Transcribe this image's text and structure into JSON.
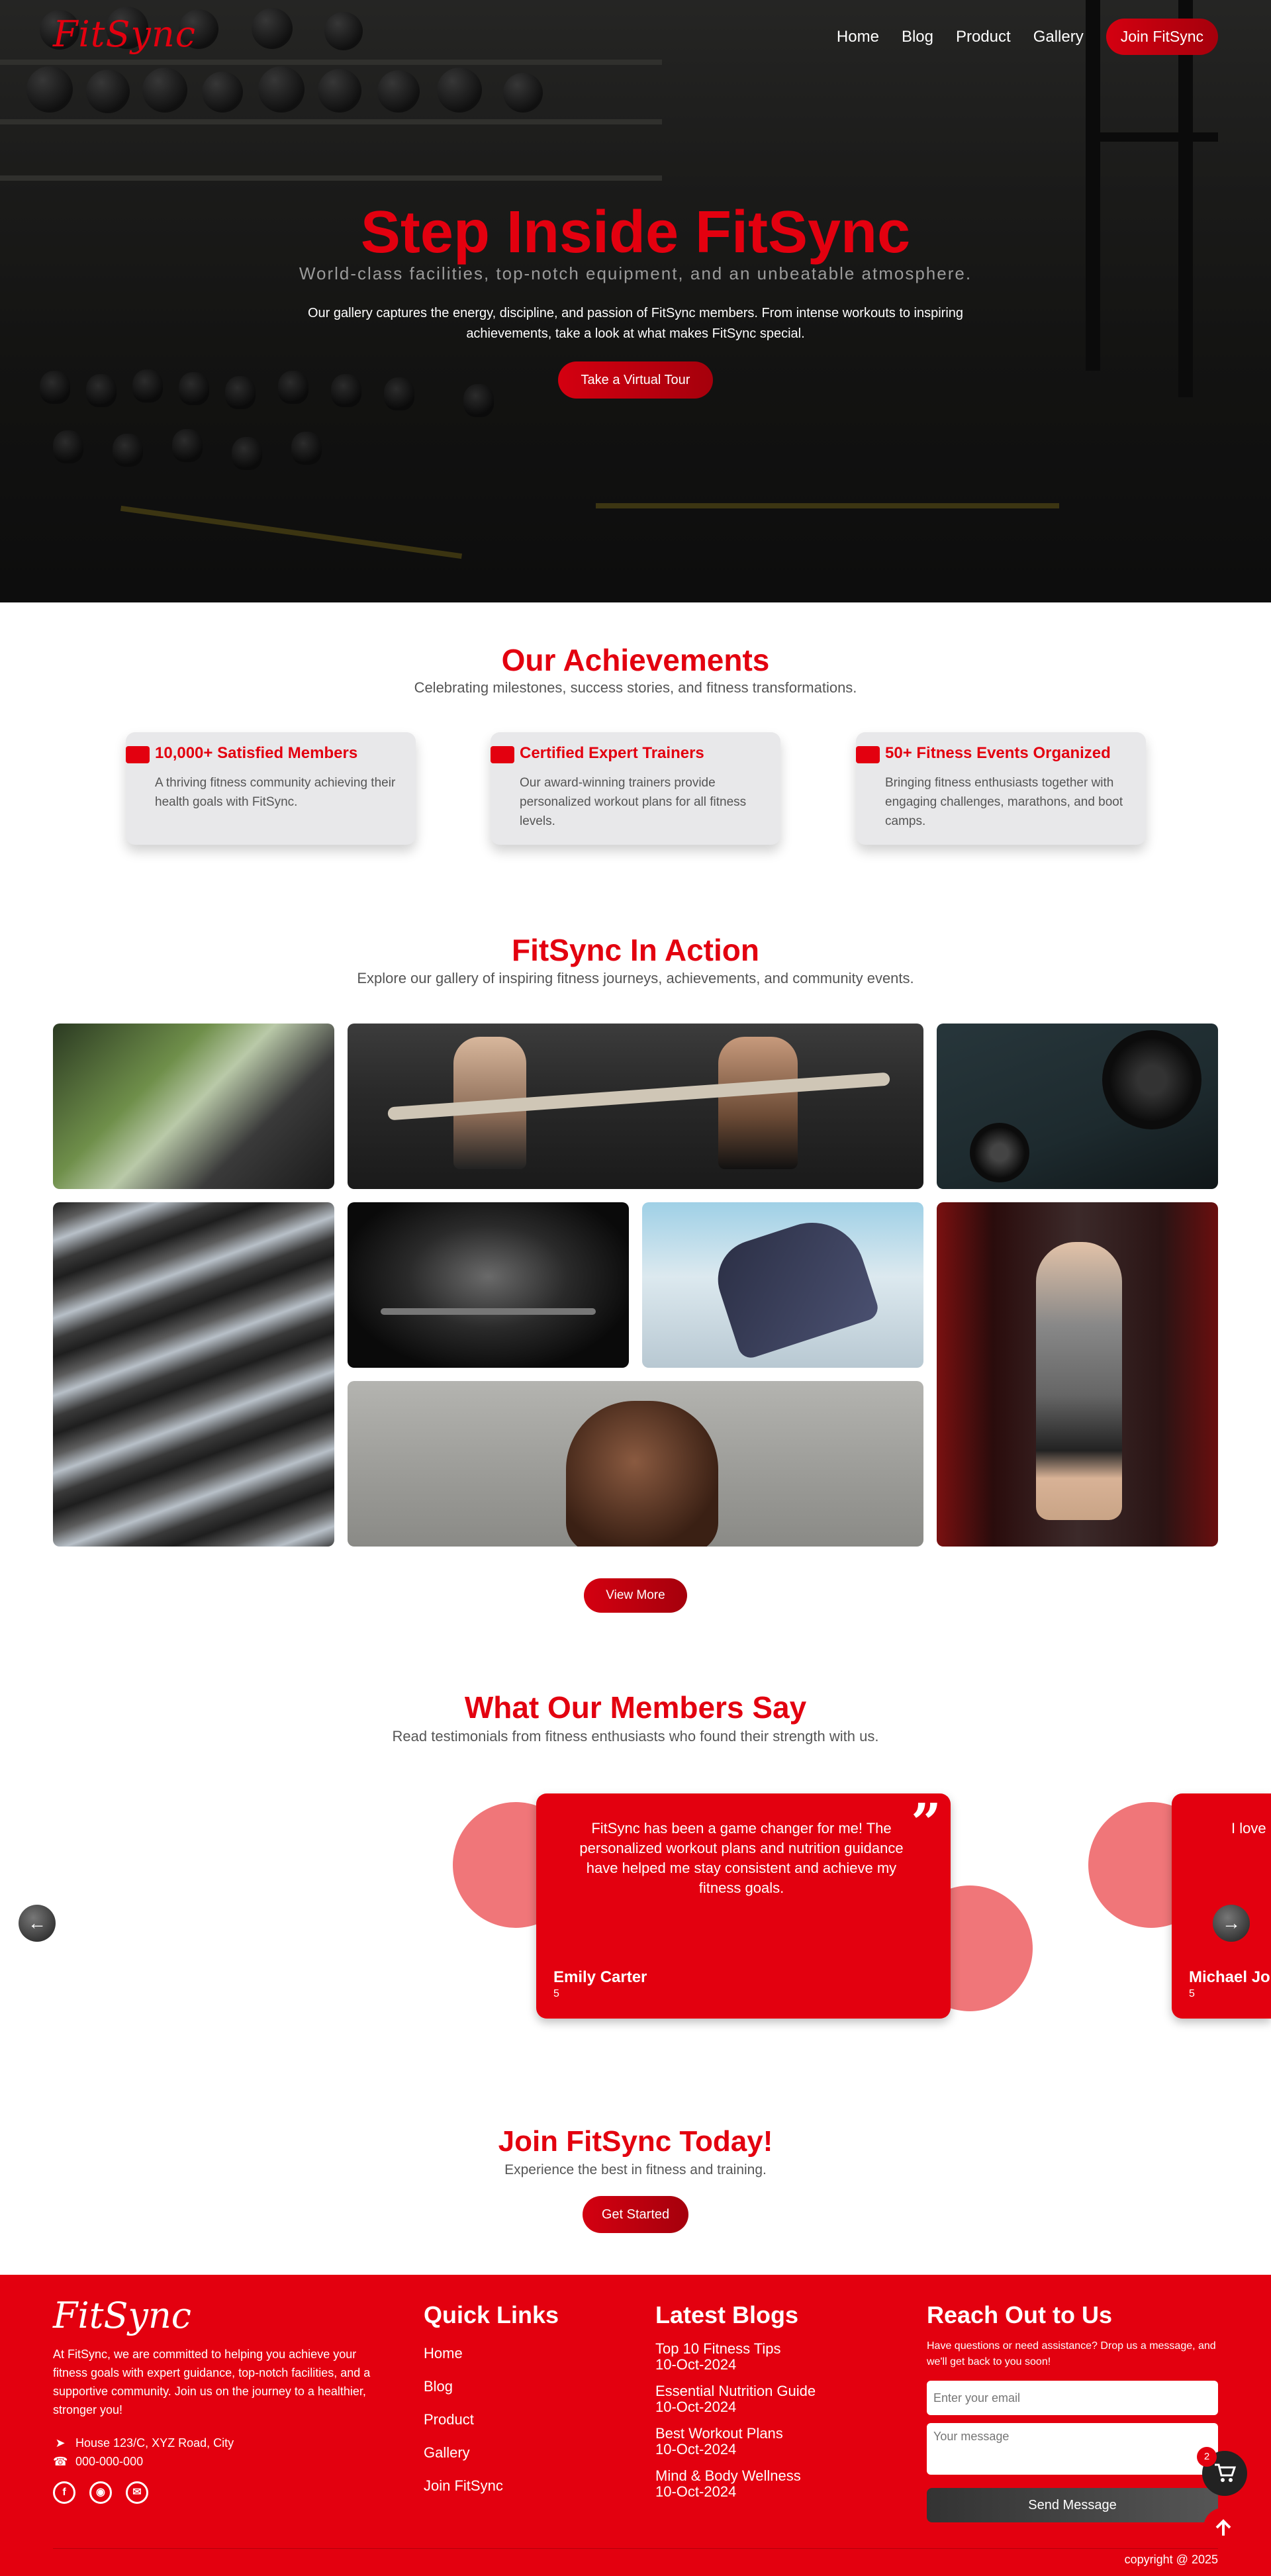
{
  "brand": {
    "logo_text": "FitSync",
    "accent": "#e3000f"
  },
  "nav": {
    "items": [
      "Home",
      "Blog",
      "Product",
      "Gallery"
    ],
    "join_label": "Join FitSync"
  },
  "hero": {
    "title": "Step Inside FitSync",
    "subtitle": "World-class facilities, top-notch equipment, and an unbeatable atmosphere.",
    "description": "Our gallery captures the energy, discipline, and passion of FitSync members. From intense workouts to inspiring achievements, take a look at what makes FitSync special.",
    "button": "Take a Virtual Tour"
  },
  "achievements": {
    "title": "Our Achievements",
    "subtitle": "Celebrating milestones, success stories, and fitness transformations.",
    "cards": [
      {
        "title": "10,000+ Satisfied Members",
        "text": "A thriving fitness community achieving their health goals with FitSync."
      },
      {
        "title": "Certified Expert Trainers",
        "text": "Our award-winning trainers provide personalized workout plans for all fitness levels."
      },
      {
        "title": "50+ Fitness Events Organized",
        "text": "Bringing fitness enthusiasts together with engaging challenges, marathons, and boot camps."
      }
    ]
  },
  "gallery": {
    "title": "FitSync In Action",
    "subtitle": "Explore our gallery of inspiring fitness journeys, achievements, and community events.",
    "button": "View More"
  },
  "testimonials": {
    "title": "What Our Members Say",
    "subtitle": "Read testimonials from fitness enthusiasts who found their strength with us.",
    "items": [
      {
        "text": "FitSync has been a game changer for me! The personalized workout plans and nutrition guidance have helped me stay consistent and achieve my fitness goals.",
        "name": "Emily Carter",
        "rating": "5"
      },
      {
        "text": "I love being part of FitSync. T",
        "name": "Michael Jo",
        "rating": "5"
      }
    ]
  },
  "cta": {
    "title": "Join FitSync Today!",
    "subtitle": "Experience the best in fitness and training.",
    "button": "Get Started"
  },
  "footer": {
    "logo_text": "FitSync",
    "about": "At FitSync, we are committed to helping you achieve your fitness goals with expert guidance, top-notch facilities, and a supportive community. Join us on the journey to a healthier, stronger you!",
    "address": "House 123/C, XYZ Road, City",
    "phone": "000-000-000",
    "quick_links_title": "Quick Links",
    "quick_links": [
      "Home",
      "Blog",
      "Product",
      "Gallery",
      "Join FitSync"
    ],
    "blogs_title": "Latest Blogs",
    "blogs": [
      {
        "title": "Top 10 Fitness Tips",
        "date": "10-Oct-2024"
      },
      {
        "title": "Essential Nutrition Guide",
        "date": "10-Oct-2024"
      },
      {
        "title": "Best Workout Plans",
        "date": "10-Oct-2024"
      },
      {
        "title": "Mind & Body Wellness",
        "date": "10-Oct-2024"
      }
    ],
    "reach_title": "Reach Out to Us",
    "reach_text": "Have questions or need assistance? Drop us a message, and we'll get back to you soon!",
    "email_placeholder": "Enter your email",
    "message_placeholder": "Your message",
    "send_label": "Send Message",
    "copyright": "copyright @ 2025"
  },
  "cart": {
    "count": "2"
  }
}
